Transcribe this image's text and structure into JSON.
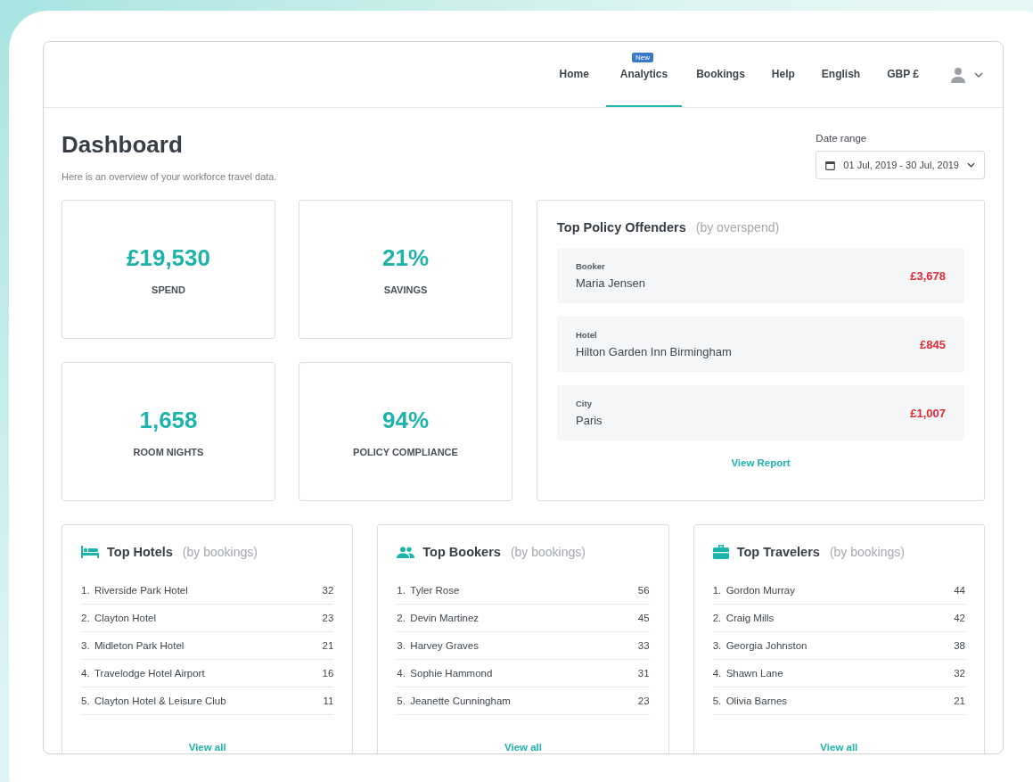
{
  "nav": {
    "items": [
      {
        "label": "Home",
        "selected": false
      },
      {
        "label": "Analytics",
        "selected": true,
        "badge": "New"
      },
      {
        "label": "Bookings",
        "selected": false
      },
      {
        "label": "Help",
        "selected": false
      },
      {
        "label": "English",
        "selected": false
      },
      {
        "label": "GBP £",
        "selected": false
      }
    ]
  },
  "header": {
    "title": "Dashboard",
    "subtitle": "Here is an overview of your workforce travel data."
  },
  "date_range": {
    "label": "Date range",
    "value": "01 Jul, 2019 - 30 Jul, 2019"
  },
  "stats": [
    {
      "value": "£19,530",
      "label": "SPEND"
    },
    {
      "value": "21%",
      "label": "SAVINGS"
    },
    {
      "value": "1,658",
      "label": "ROOM NIGHTS"
    },
    {
      "value": "94%",
      "label": "POLICY COMPLIANCE"
    }
  ],
  "offenders": {
    "title": "Top Policy Offenders",
    "subtitle": "(by overspend)",
    "items": [
      {
        "category": "Booker",
        "name": "Maria Jensen",
        "amount": "£3,678"
      },
      {
        "category": "Hotel",
        "name": "Hilton Garden Inn Birmingham",
        "amount": "£845"
      },
      {
        "category": "City",
        "name": "Paris",
        "amount": "£1,007"
      }
    ],
    "link": "View Report"
  },
  "panels": [
    {
      "kind": "hotels",
      "title": "Top Hotels",
      "subtitle": "(by bookings)",
      "link": "View all",
      "items": [
        {
          "rank": "1.",
          "name": "Riverside Park Hotel",
          "count": "32"
        },
        {
          "rank": "2.",
          "name": "Clayton Hotel",
          "count": "23"
        },
        {
          "rank": "3.",
          "name": "Midleton Park Hotel",
          "count": "21"
        },
        {
          "rank": "4.",
          "name": "Travelodge Hotel Airport",
          "count": "16"
        },
        {
          "rank": "5.",
          "name": "Clayton Hotel & Leisure Club",
          "count": "11"
        }
      ]
    },
    {
      "kind": "bookers",
      "title": "Top Bookers",
      "subtitle": "(by bookings)",
      "link": "View all",
      "items": [
        {
          "rank": "1.",
          "name": "Tyler Rose",
          "count": "56"
        },
        {
          "rank": "2.",
          "name": "Devin Martinez",
          "count": "45"
        },
        {
          "rank": "3.",
          "name": "Harvey Graves",
          "count": "33"
        },
        {
          "rank": "4.",
          "name": "Sophie Hammond",
          "count": "31"
        },
        {
          "rank": "5.",
          "name": "Jeanette Cunningham",
          "count": "23"
        }
      ]
    },
    {
      "kind": "travelers",
      "title": "Top Travelers",
      "subtitle": "(by bookings)",
      "link": "View all",
      "items": [
        {
          "rank": "1.",
          "name": "Gordon Murray",
          "count": "44"
        },
        {
          "rank": "2.",
          "name": "Craig Mills",
          "count": "42"
        },
        {
          "rank": "3.",
          "name": "Georgia Johnston",
          "count": "38"
        },
        {
          "rank": "4.",
          "name": "Shawn Lane",
          "count": "32"
        },
        {
          "rank": "5.",
          "name": "Olivia Barnes",
          "count": "21"
        }
      ]
    }
  ]
}
